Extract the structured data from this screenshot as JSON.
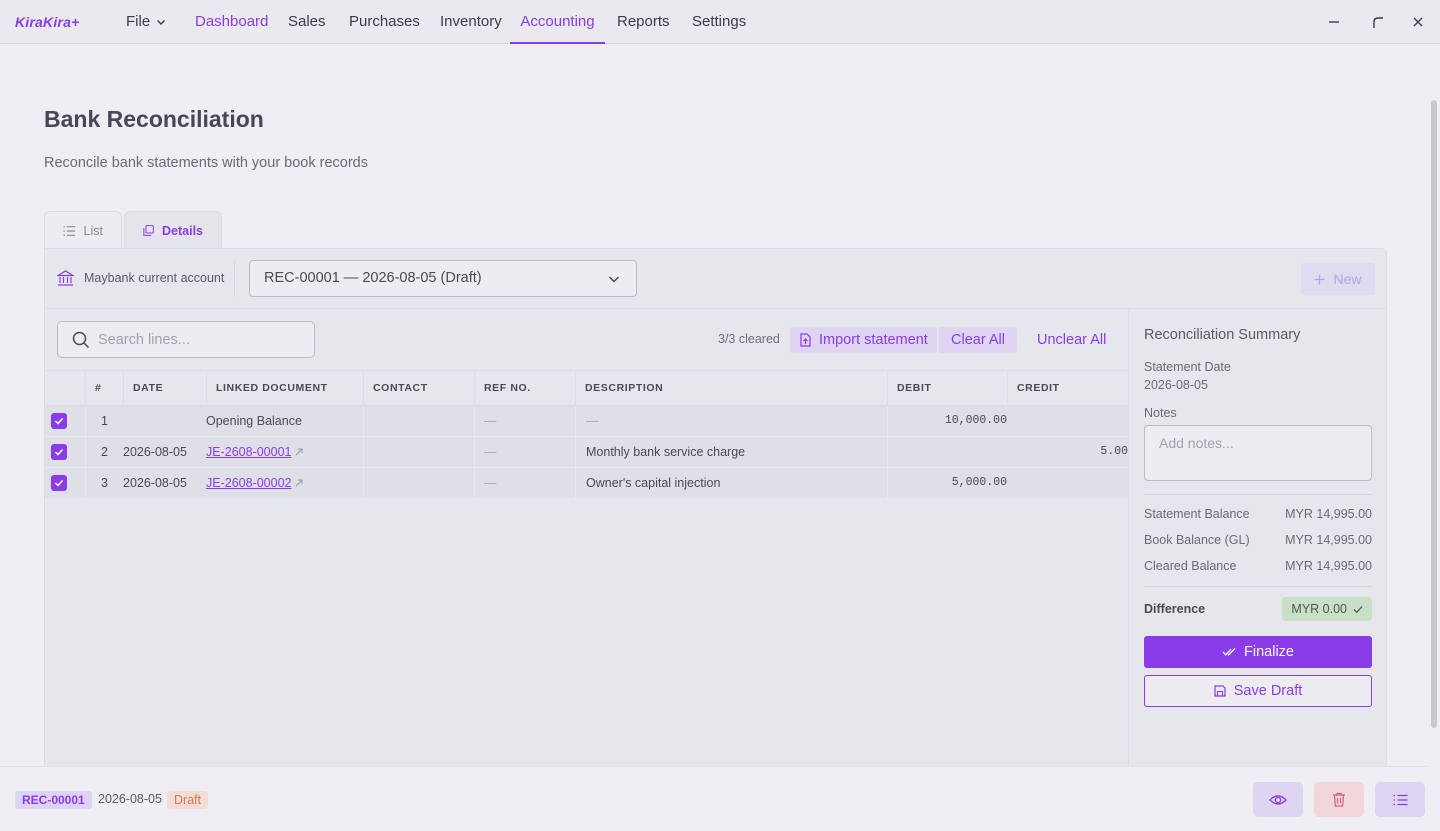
{
  "app": {
    "name": "KiraKira+"
  },
  "nav": {
    "file": "File",
    "items": [
      "Dashboard",
      "Sales",
      "Purchases",
      "Inventory",
      "Accounting",
      "Reports",
      "Settings"
    ],
    "active": "Accounting",
    "highlighted": "Dashboard"
  },
  "page": {
    "title": "Bank Reconciliation",
    "subtitle": "Reconcile bank statements with your book records"
  },
  "tabs": {
    "list": "List",
    "details": "Details"
  },
  "account": {
    "name": "Maybank current account"
  },
  "reconciliation_select": {
    "value": "REC-00001 — 2026-08-05 (Draft)"
  },
  "new_button": "New",
  "search": {
    "placeholder": "Search lines..."
  },
  "toolbar": {
    "cleared": "3/3 cleared",
    "import": "Import statement",
    "clear_all": "Clear All",
    "unclear_all": "Unclear All"
  },
  "table": {
    "headers": [
      "#",
      "DATE",
      "LINKED DOCUMENT",
      "CONTACT",
      "REF NO.",
      "DESCRIPTION",
      "DEBIT",
      "CREDIT"
    ],
    "rows": [
      {
        "num": "1",
        "date": "",
        "linked": "Opening Balance",
        "linked_is_link": false,
        "contact": "",
        "ref": "—",
        "description": "—",
        "debit": "10,000.00",
        "credit": "",
        "checked": true
      },
      {
        "num": "2",
        "date": "2026-08-05",
        "linked": "JE-2608-00001",
        "linked_is_link": true,
        "contact": "",
        "ref": "—",
        "description": "Monthly bank service charge",
        "debit": "",
        "credit": "5.00",
        "checked": true
      },
      {
        "num": "3",
        "date": "2026-08-05",
        "linked": "JE-2608-00002",
        "linked_is_link": true,
        "contact": "",
        "ref": "—",
        "description": "Owner's capital injection",
        "debit": "5,000.00",
        "credit": "",
        "checked": true
      }
    ]
  },
  "summary": {
    "title": "Reconciliation Summary",
    "statement_date_label": "Statement Date",
    "statement_date": "2026-08-05",
    "notes_label": "Notes",
    "notes_placeholder": "Add notes...",
    "statement_balance_label": "Statement Balance",
    "statement_balance": "MYR 14,995.00",
    "book_balance_label": "Book Balance (GL)",
    "book_balance": "MYR 14,995.00",
    "cleared_balance_label": "Cleared Balance",
    "cleared_balance": "MYR 14,995.00",
    "difference_label": "Difference",
    "difference": "MYR 0.00",
    "finalize": "Finalize",
    "save_draft": "Save Draft"
  },
  "footer": {
    "rec_id": "REC-00001",
    "date": "2026-08-05",
    "status": "Draft"
  },
  "colors": {
    "accent": "#8a3ce8",
    "background": "#eeeef3",
    "draft": "#d07a58",
    "success_bg": "#c9dfc8"
  }
}
